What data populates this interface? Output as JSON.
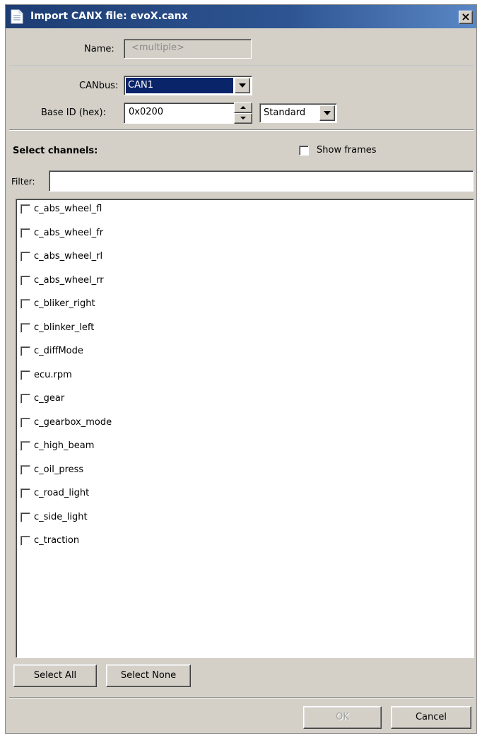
{
  "window": {
    "title": "Import CANX file: evoX.canx",
    "close_label": "×"
  },
  "form": {
    "name_label": "Name:",
    "name_value": "<multiple>",
    "canbus_label": "CANbus:",
    "canbus_value": "CAN1",
    "base_id_label": "Base ID (hex):",
    "base_id_value": "0x0200",
    "id_type_value": "Standard"
  },
  "channels": {
    "heading": "Select channels:",
    "show_frames_label": "Show frames",
    "show_frames_checked": false,
    "filter_label": "Filter:",
    "filter_value": "",
    "items": [
      {
        "label": "c_abs_wheel_fl",
        "checked": false
      },
      {
        "label": "c_abs_wheel_fr",
        "checked": false
      },
      {
        "label": "c_abs_wheel_rl",
        "checked": false
      },
      {
        "label": "c_abs_wheel_rr",
        "checked": false
      },
      {
        "label": "c_bliker_right",
        "checked": false
      },
      {
        "label": "c_blinker_left",
        "checked": false
      },
      {
        "label": "c_diffMode",
        "checked": false
      },
      {
        "label": "ecu.rpm",
        "checked": false
      },
      {
        "label": "c_gear",
        "checked": false
      },
      {
        "label": "c_gearbox_mode",
        "checked": false
      },
      {
        "label": "c_high_beam",
        "checked": false
      },
      {
        "label": "c_oil_press",
        "checked": false
      },
      {
        "label": "c_road_light",
        "checked": false
      },
      {
        "label": "c_side_light",
        "checked": false
      },
      {
        "label": "c_traction",
        "checked": false
      }
    ]
  },
  "buttons": {
    "select_all": "Select All",
    "select_none": "Select None",
    "ok": "OK",
    "cancel": "Cancel"
  },
  "colors": {
    "title_bar": "#1d3d73",
    "selection": "#0a246a",
    "dialog_face": "#d4d0c8"
  }
}
